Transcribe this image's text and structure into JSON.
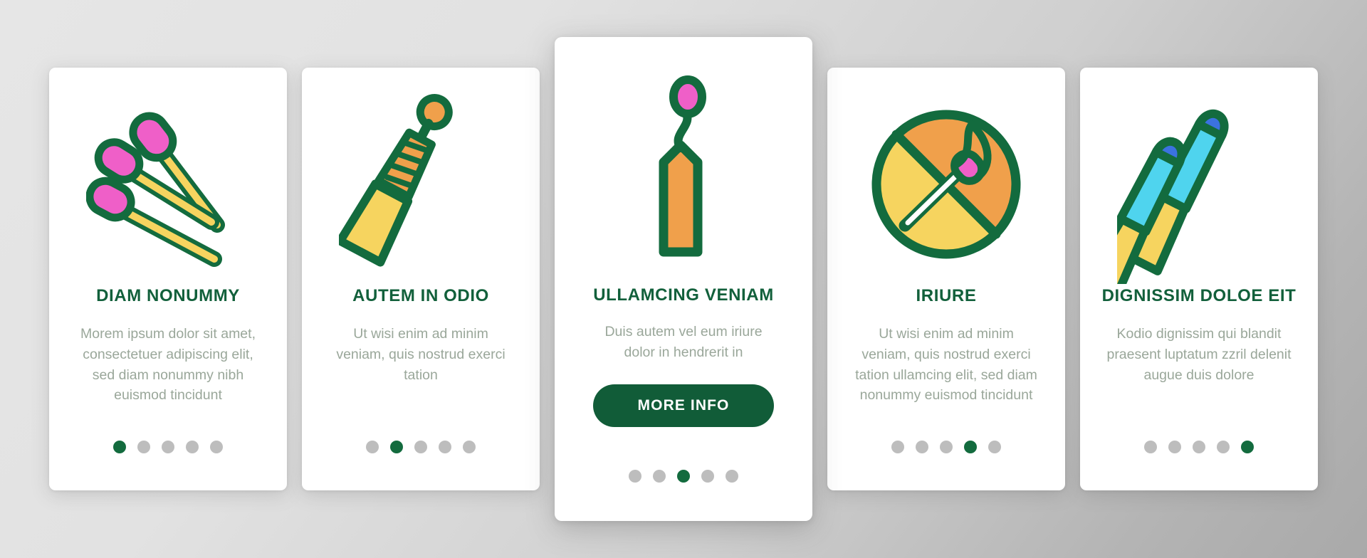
{
  "theme": {
    "background_start": "#e6e6e6",
    "background_end": "#a9a9a9",
    "card_background": "#ffffff",
    "title_color": "#12603b",
    "body_text_color": "#9aa79a",
    "accent_green": "#115c38",
    "dot_inactive": "#bdbdbd",
    "dot_active": "#136b3e",
    "icon_outline": "#136b3e",
    "icon_yellow": "#f6d45f",
    "icon_orange": "#f0a04b",
    "icon_pink": "#ef5fc8",
    "icon_cyan": "#4fd4ee",
    "icon_blue": "#3b72e0"
  },
  "cards": [
    {
      "title": "DIAM NONUMMY",
      "description": "Morem ipsum dolor sit amet, consectetuer adipiscing elit, sed diam nonummy nibh euismod tincidunt",
      "icon_name": "three-matchsticks-icon",
      "dots_total": 5,
      "active_dot": 1,
      "featured": false,
      "button_label": null
    },
    {
      "title": "AUTEM IN ODIO",
      "description": "Ut wisi enim ad minim veniam, quis nostrud exerci tation",
      "icon_name": "torch-flare-icon",
      "dots_total": 5,
      "active_dot": 2,
      "featured": false,
      "button_label": null
    },
    {
      "title": "ULLAMCING VENIAM",
      "description": "Duis autem vel eum iriure dolor in hendrerit in",
      "icon_name": "burning-match-smoke-icon",
      "dots_total": 5,
      "active_dot": 3,
      "featured": true,
      "button_label": "MORE INFO"
    },
    {
      "title": "IRIURE",
      "description": "Ut wisi enim ad minim veniam, quis nostrud exerci tation ullamcing elit, sed diam nonummy euismod tincidunt",
      "icon_name": "no-matches-prohibition-icon",
      "dots_total": 5,
      "active_dot": 4,
      "featured": false,
      "button_label": null
    },
    {
      "title": "DIGNISSIM DOLOE EIT",
      "description": "Kodio dignissim qui blandit praesent luptatum zzril delenit augue duis dolore",
      "icon_name": "two-blue-matches-icon",
      "dots_total": 5,
      "active_dot": 5,
      "featured": false,
      "button_label": null
    }
  ]
}
